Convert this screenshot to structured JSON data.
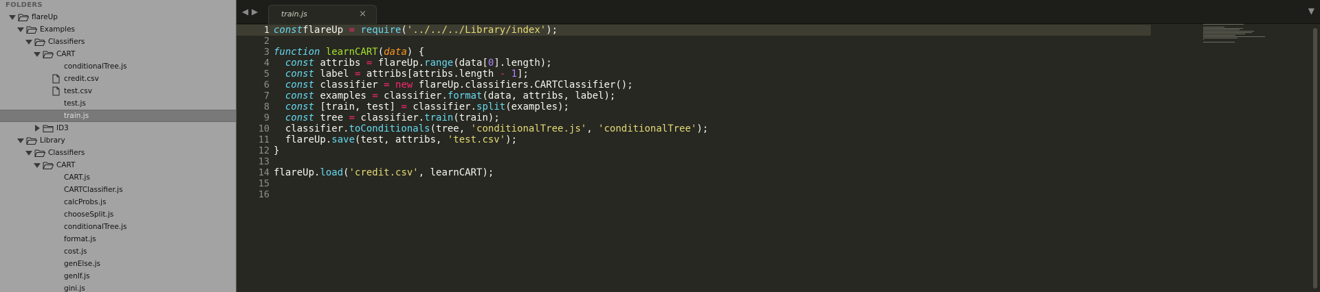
{
  "sidebar": {
    "title": "FOLDERS",
    "items": [
      {
        "label": "flareUp",
        "type": "folder",
        "expanded": true,
        "depth": 0
      },
      {
        "label": "Examples",
        "type": "folder",
        "expanded": true,
        "depth": 1
      },
      {
        "label": "Classifiers",
        "type": "folder",
        "expanded": true,
        "depth": 2
      },
      {
        "label": "CART",
        "type": "folder",
        "expanded": true,
        "depth": 3
      },
      {
        "label": "conditionalTree.js",
        "type": "file",
        "depth": 4
      },
      {
        "label": "credit.csv",
        "type": "file-doc",
        "depth": 4
      },
      {
        "label": "test.csv",
        "type": "file-doc",
        "depth": 4
      },
      {
        "label": "test.js",
        "type": "file",
        "depth": 4
      },
      {
        "label": "train.js",
        "type": "file",
        "depth": 4,
        "selected": true
      },
      {
        "label": "ID3",
        "type": "folder",
        "expanded": false,
        "depth": 3
      },
      {
        "label": "Library",
        "type": "folder",
        "expanded": true,
        "depth": 1
      },
      {
        "label": "Classifiers",
        "type": "folder",
        "expanded": true,
        "depth": 2
      },
      {
        "label": "CART",
        "type": "folder",
        "expanded": true,
        "depth": 3
      },
      {
        "label": "CART.js",
        "type": "file",
        "depth": 4
      },
      {
        "label": "CARTClassifier.js",
        "type": "file",
        "depth": 4
      },
      {
        "label": "calcProbs.js",
        "type": "file",
        "depth": 4
      },
      {
        "label": "chooseSplit.js",
        "type": "file",
        "depth": 4
      },
      {
        "label": "conditionalTree.js",
        "type": "file",
        "depth": 4
      },
      {
        "label": "format.js",
        "type": "file",
        "depth": 4
      },
      {
        "label": "cost.js",
        "type": "file",
        "depth": 4
      },
      {
        "label": "genElse.js",
        "type": "file",
        "depth": 4
      },
      {
        "label": "genIf.js",
        "type": "file",
        "depth": 4
      },
      {
        "label": "gini.js",
        "type": "file",
        "depth": 4
      }
    ]
  },
  "tabbar": {
    "prev_icon": "◀",
    "next_icon": "▶",
    "active_tab": "train.js",
    "close_icon": "×",
    "overflow_icon": "▼"
  },
  "editor": {
    "current_line": 1,
    "line_numbers": [
      "1",
      "2",
      "3",
      "4",
      "5",
      "6",
      "7",
      "8",
      "9",
      "10",
      "11",
      "12",
      "13",
      "14",
      "15",
      "16"
    ],
    "lines": [
      [
        [
          "kw",
          "const"
        ],
        [
          "",
          "flareUp "
        ],
        [
          "op",
          "="
        ],
        [
          "",
          " "
        ],
        [
          "call",
          "require"
        ],
        [
          "",
          "("
        ],
        [
          "str",
          "'../../../Library/index'"
        ],
        [
          "",
          ");"
        ]
      ],
      [],
      [
        [
          "kw",
          "function"
        ],
        [
          "",
          " "
        ],
        [
          "fn",
          "learnCART"
        ],
        [
          "",
          "("
        ],
        [
          "param",
          "data"
        ],
        [
          "",
          ") {"
        ]
      ],
      [
        [
          "",
          "  "
        ],
        [
          "kw",
          "const"
        ],
        [
          "",
          " attribs "
        ],
        [
          "op",
          "="
        ],
        [
          "",
          " flareUp."
        ],
        [
          "call",
          "range"
        ],
        [
          "",
          "(data["
        ],
        [
          "num",
          "0"
        ],
        [
          "",
          "].length);"
        ]
      ],
      [
        [
          "",
          "  "
        ],
        [
          "kw",
          "const"
        ],
        [
          "",
          " label "
        ],
        [
          "op",
          "="
        ],
        [
          "",
          " attribs[attribs.length "
        ],
        [
          "op",
          "-"
        ],
        [
          "",
          " "
        ],
        [
          "num",
          "1"
        ],
        [
          "",
          "];"
        ]
      ],
      [
        [
          "",
          "  "
        ],
        [
          "kw",
          "const"
        ],
        [
          "",
          " classifier "
        ],
        [
          "op",
          "="
        ],
        [
          "",
          " "
        ],
        [
          "op",
          "new"
        ],
        [
          "",
          " flareUp.classifiers.CARTClassifier();"
        ]
      ],
      [
        [
          "",
          "  "
        ],
        [
          "kw",
          "const"
        ],
        [
          "",
          " examples "
        ],
        [
          "op",
          "="
        ],
        [
          "",
          " classifier."
        ],
        [
          "call",
          "format"
        ],
        [
          "",
          "(data, attribs, label);"
        ]
      ],
      [
        [
          "",
          "  "
        ],
        [
          "kw",
          "const"
        ],
        [
          "",
          " [train, test] "
        ],
        [
          "op",
          "="
        ],
        [
          "",
          " classifier."
        ],
        [
          "call",
          "split"
        ],
        [
          "",
          "(examples);"
        ]
      ],
      [
        [
          "",
          "  "
        ],
        [
          "kw",
          "const"
        ],
        [
          "",
          " tree "
        ],
        [
          "op",
          "="
        ],
        [
          "",
          " classifier."
        ],
        [
          "call",
          "train"
        ],
        [
          "",
          "(train);"
        ]
      ],
      [
        [
          "",
          "  classifier."
        ],
        [
          "call",
          "toConditionals"
        ],
        [
          "",
          "(tree, "
        ],
        [
          "str",
          "'conditionalTree.js'"
        ],
        [
          "",
          ", "
        ],
        [
          "str",
          "'conditionalTree'"
        ],
        [
          "",
          ");"
        ]
      ],
      [
        [
          "",
          "  flareUp."
        ],
        [
          "call",
          "save"
        ],
        [
          "",
          "(test, attribs, "
        ],
        [
          "str",
          "'test.csv'"
        ],
        [
          "",
          ");"
        ]
      ],
      [
        [
          "",
          "}"
        ]
      ],
      [],
      [
        [
          "",
          "flareUp."
        ],
        [
          "call",
          "load"
        ],
        [
          "",
          "("
        ],
        [
          "str",
          "'credit.csv'"
        ],
        [
          "",
          ", learnCART);"
        ]
      ],
      [],
      []
    ]
  }
}
